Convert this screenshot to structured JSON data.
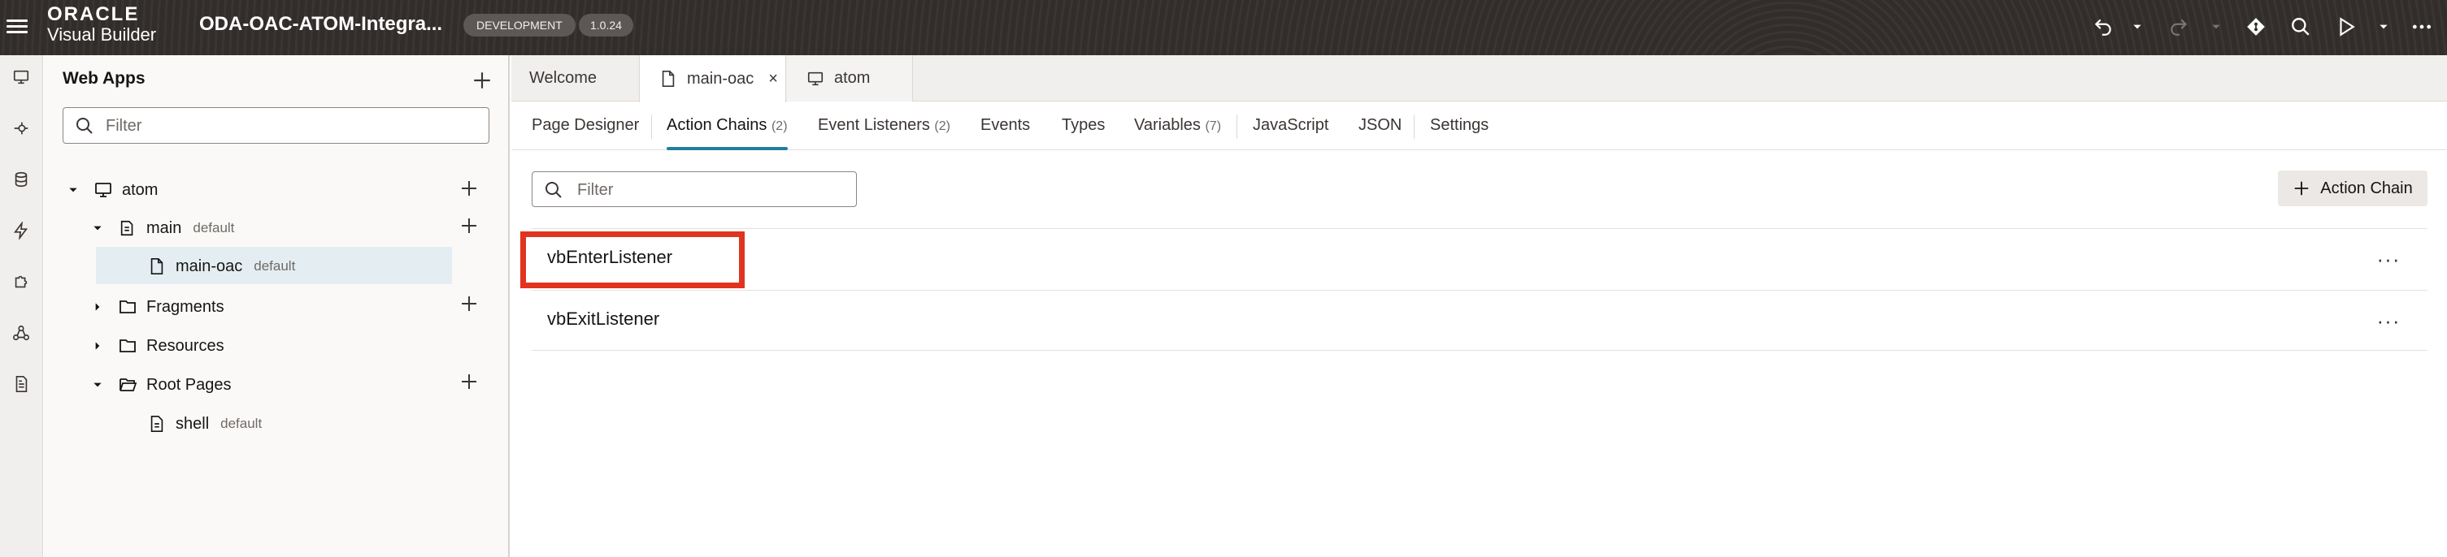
{
  "header": {
    "brand": "ORACLE",
    "product": "Visual Builder",
    "app_title": "ODA-OAC-ATOM-Integra...",
    "env_badge": "DEVELOPMENT",
    "version_badge": "1.0.24",
    "icons": [
      "menu-icon",
      "undo-icon",
      "chevron-down-icon",
      "redo-icon",
      "chevron-down-icon",
      "git-icon",
      "search-icon",
      "run-icon",
      "chevron-down-icon",
      "more-icon"
    ]
  },
  "rail": {
    "icons": [
      "web-apps-icon",
      "services-icon",
      "business-objects-icon",
      "processes-icon",
      "components-icon",
      "source-icon",
      "documents-icon"
    ]
  },
  "navigator": {
    "title": "Web Apps",
    "filter_placeholder": "Filter",
    "tree": [
      {
        "label": "atom",
        "meta": ""
      },
      {
        "label": "main",
        "meta": "default"
      },
      {
        "label": "main-oac",
        "meta": "default"
      },
      {
        "label": "Fragments",
        "meta": ""
      },
      {
        "label": "Resources",
        "meta": ""
      },
      {
        "label": "Root Pages",
        "meta": ""
      },
      {
        "label": "shell",
        "meta": "default"
      }
    ]
  },
  "doc_tabs": [
    {
      "label": "Welcome"
    },
    {
      "label": "main-oac",
      "active": true
    },
    {
      "label": "atom"
    }
  ],
  "sub_tabs": [
    {
      "label": "Page Designer",
      "count": ""
    },
    {
      "label": "Action Chains",
      "count": "(2)",
      "active": true
    },
    {
      "label": "Event Listeners",
      "count": "(2)"
    },
    {
      "label": "Events",
      "count": ""
    },
    {
      "label": "Types",
      "count": ""
    },
    {
      "label": "Variables",
      "count": "(7)"
    },
    {
      "label": "JavaScript",
      "count": ""
    },
    {
      "label": "JSON",
      "count": ""
    },
    {
      "label": "Settings",
      "count": ""
    }
  ],
  "main": {
    "filter_placeholder": "Filter",
    "add_button_label": "Action Chain",
    "chains": [
      {
        "name": "vbEnterListener"
      },
      {
        "name": "vbExitListener"
      }
    ],
    "more_label": "···"
  },
  "colors": {
    "header_bg": "#312d2a",
    "accent": "#227e9e",
    "highlight": "#e0341f",
    "selected_row": "#e4eef2"
  }
}
